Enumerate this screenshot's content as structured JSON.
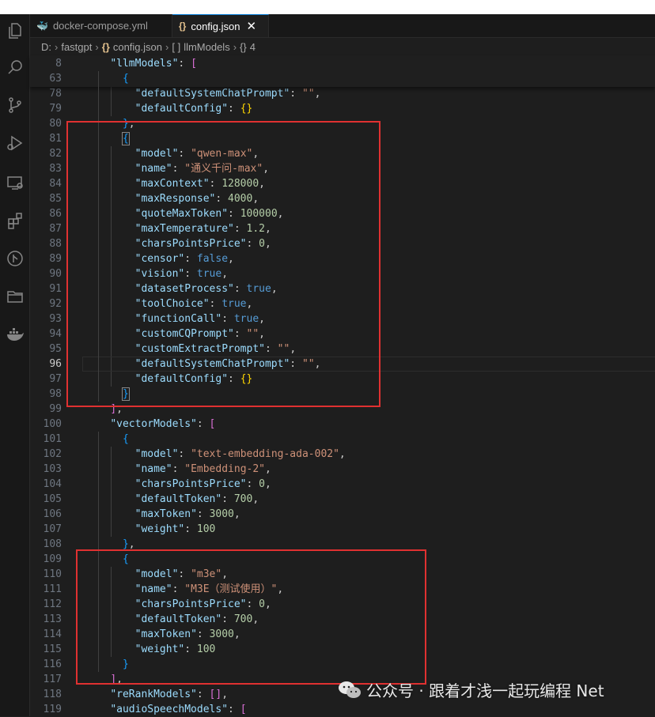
{
  "tabs": [
    {
      "label": "docker-compose.yml",
      "icon": "docker-icon",
      "active": false
    },
    {
      "label": "config.json",
      "icon": "json-braces-icon",
      "active": true,
      "close": "✕"
    }
  ],
  "breadcrumb": {
    "items": [
      "D:",
      "fastgpt",
      "config.json",
      "llmModels",
      "4"
    ],
    "icons": [
      "",
      "",
      "{}",
      "[ ]",
      "{}"
    ]
  },
  "editor": {
    "current_line": "96",
    "lines": [
      {
        "n": "8",
        "t": [
          [
            "p",
            "    "
          ],
          [
            "k",
            "\"llmModels\""
          ],
          [
            "p",
            ": "
          ],
          [
            "br2",
            "["
          ]
        ]
      },
      {
        "n": "63",
        "t": [
          [
            "p",
            "      "
          ],
          [
            "br3",
            "{"
          ]
        ]
      },
      {
        "n": "78",
        "t": [
          [
            "p",
            "        "
          ],
          [
            "k",
            "\"defaultSystemChatPrompt\""
          ],
          [
            "p",
            ": "
          ],
          [
            "s",
            "\"\""
          ],
          [
            "p",
            ","
          ]
        ]
      },
      {
        "n": "79",
        "t": [
          [
            "p",
            "        "
          ],
          [
            "k",
            "\"defaultConfig\""
          ],
          [
            "p",
            ": "
          ],
          [
            "br1",
            "{}"
          ]
        ]
      },
      {
        "n": "80",
        "t": [
          [
            "p",
            "      "
          ],
          [
            "br3",
            "}"
          ],
          [
            "p",
            ","
          ]
        ]
      },
      {
        "n": "81",
        "t": [
          [
            "p",
            "      "
          ],
          [
            "br3",
            "{"
          ]
        ]
      },
      {
        "n": "82",
        "t": [
          [
            "p",
            "        "
          ],
          [
            "k",
            "\"model\""
          ],
          [
            "p",
            ": "
          ],
          [
            "s",
            "\"qwen-max\""
          ],
          [
            "p",
            ","
          ]
        ]
      },
      {
        "n": "83",
        "t": [
          [
            "p",
            "        "
          ],
          [
            "k",
            "\"name\""
          ],
          [
            "p",
            ": "
          ],
          [
            "s",
            "\"通义千问-max\""
          ],
          [
            "p",
            ","
          ]
        ]
      },
      {
        "n": "84",
        "t": [
          [
            "p",
            "        "
          ],
          [
            "k",
            "\"maxContext\""
          ],
          [
            "p",
            ": "
          ],
          [
            "n",
            "128000"
          ],
          [
            "p",
            ","
          ]
        ]
      },
      {
        "n": "85",
        "t": [
          [
            "p",
            "        "
          ],
          [
            "k",
            "\"maxResponse\""
          ],
          [
            "p",
            ": "
          ],
          [
            "n",
            "4000"
          ],
          [
            "p",
            ","
          ]
        ]
      },
      {
        "n": "86",
        "t": [
          [
            "p",
            "        "
          ],
          [
            "k",
            "\"quoteMaxToken\""
          ],
          [
            "p",
            ": "
          ],
          [
            "n",
            "100000"
          ],
          [
            "p",
            ","
          ]
        ]
      },
      {
        "n": "87",
        "t": [
          [
            "p",
            "        "
          ],
          [
            "k",
            "\"maxTemperature\""
          ],
          [
            "p",
            ": "
          ],
          [
            "n",
            "1.2"
          ],
          [
            "p",
            ","
          ]
        ]
      },
      {
        "n": "88",
        "t": [
          [
            "p",
            "        "
          ],
          [
            "k",
            "\"charsPointsPrice\""
          ],
          [
            "p",
            ": "
          ],
          [
            "n",
            "0"
          ],
          [
            "p",
            ","
          ]
        ]
      },
      {
        "n": "89",
        "t": [
          [
            "p",
            "        "
          ],
          [
            "k",
            "\"censor\""
          ],
          [
            "p",
            ": "
          ],
          [
            "b",
            "false"
          ],
          [
            "p",
            ","
          ]
        ]
      },
      {
        "n": "90",
        "t": [
          [
            "p",
            "        "
          ],
          [
            "k",
            "\"vision\""
          ],
          [
            "p",
            ": "
          ],
          [
            "b",
            "true"
          ],
          [
            "p",
            ","
          ]
        ]
      },
      {
        "n": "91",
        "t": [
          [
            "p",
            "        "
          ],
          [
            "k",
            "\"datasetProcess\""
          ],
          [
            "p",
            ": "
          ],
          [
            "b",
            "true"
          ],
          [
            "p",
            ","
          ]
        ]
      },
      {
        "n": "92",
        "t": [
          [
            "p",
            "        "
          ],
          [
            "k",
            "\"toolChoice\""
          ],
          [
            "p",
            ": "
          ],
          [
            "b",
            "true"
          ],
          [
            "p",
            ","
          ]
        ]
      },
      {
        "n": "93",
        "t": [
          [
            "p",
            "        "
          ],
          [
            "k",
            "\"functionCall\""
          ],
          [
            "p",
            ": "
          ],
          [
            "b",
            "true"
          ],
          [
            "p",
            ","
          ]
        ]
      },
      {
        "n": "94",
        "t": [
          [
            "p",
            "        "
          ],
          [
            "k",
            "\"customCQPrompt\""
          ],
          [
            "p",
            ": "
          ],
          [
            "s",
            "\"\""
          ],
          [
            "p",
            ","
          ]
        ]
      },
      {
        "n": "95",
        "t": [
          [
            "p",
            "        "
          ],
          [
            "k",
            "\"customExtractPrompt\""
          ],
          [
            "p",
            ": "
          ],
          [
            "s",
            "\"\""
          ],
          [
            "p",
            ","
          ]
        ]
      },
      {
        "n": "96",
        "t": [
          [
            "p",
            "        "
          ],
          [
            "k",
            "\"defaultSystemChatPrompt\""
          ],
          [
            "p",
            ": "
          ],
          [
            "s",
            "\"\""
          ],
          [
            "p",
            ","
          ]
        ]
      },
      {
        "n": "97",
        "t": [
          [
            "p",
            "        "
          ],
          [
            "k",
            "\"defaultConfig\""
          ],
          [
            "p",
            ": "
          ],
          [
            "br1",
            "{}"
          ]
        ]
      },
      {
        "n": "98",
        "t": [
          [
            "p",
            "      "
          ],
          [
            "br3",
            "}"
          ]
        ]
      },
      {
        "n": "99",
        "t": [
          [
            "p",
            "    "
          ],
          [
            "br2",
            "]"
          ],
          [
            "p",
            ","
          ]
        ]
      },
      {
        "n": "100",
        "t": [
          [
            "p",
            "    "
          ],
          [
            "k",
            "\"vectorModels\""
          ],
          [
            "p",
            ": "
          ],
          [
            "br2",
            "["
          ]
        ]
      },
      {
        "n": "101",
        "t": [
          [
            "p",
            "      "
          ],
          [
            "br3",
            "{"
          ]
        ]
      },
      {
        "n": "102",
        "t": [
          [
            "p",
            "        "
          ],
          [
            "k",
            "\"model\""
          ],
          [
            "p",
            ": "
          ],
          [
            "s",
            "\"text-embedding-ada-002\""
          ],
          [
            "p",
            ","
          ]
        ]
      },
      {
        "n": "103",
        "t": [
          [
            "p",
            "        "
          ],
          [
            "k",
            "\"name\""
          ],
          [
            "p",
            ": "
          ],
          [
            "s",
            "\"Embedding-2\""
          ],
          [
            "p",
            ","
          ]
        ]
      },
      {
        "n": "104",
        "t": [
          [
            "p",
            "        "
          ],
          [
            "k",
            "\"charsPointsPrice\""
          ],
          [
            "p",
            ": "
          ],
          [
            "n",
            "0"
          ],
          [
            "p",
            ","
          ]
        ]
      },
      {
        "n": "105",
        "t": [
          [
            "p",
            "        "
          ],
          [
            "k",
            "\"defaultToken\""
          ],
          [
            "p",
            ": "
          ],
          [
            "n",
            "700"
          ],
          [
            "p",
            ","
          ]
        ]
      },
      {
        "n": "106",
        "t": [
          [
            "p",
            "        "
          ],
          [
            "k",
            "\"maxToken\""
          ],
          [
            "p",
            ": "
          ],
          [
            "n",
            "3000"
          ],
          [
            "p",
            ","
          ]
        ]
      },
      {
        "n": "107",
        "t": [
          [
            "p",
            "        "
          ],
          [
            "k",
            "\"weight\""
          ],
          [
            "p",
            ": "
          ],
          [
            "n",
            "100"
          ]
        ]
      },
      {
        "n": "108",
        "t": [
          [
            "p",
            "      "
          ],
          [
            "br3",
            "}"
          ],
          [
            "p",
            ","
          ]
        ]
      },
      {
        "n": "109",
        "t": [
          [
            "p",
            "      "
          ],
          [
            "br3",
            "{"
          ]
        ]
      },
      {
        "n": "110",
        "t": [
          [
            "p",
            "        "
          ],
          [
            "k",
            "\"model\""
          ],
          [
            "p",
            ": "
          ],
          [
            "s",
            "\"m3e\""
          ],
          [
            "p",
            ","
          ]
        ]
      },
      {
        "n": "111",
        "t": [
          [
            "p",
            "        "
          ],
          [
            "k",
            "\"name\""
          ],
          [
            "p",
            ": "
          ],
          [
            "s",
            "\"M3E（测试使用）\""
          ],
          [
            "p",
            ","
          ]
        ]
      },
      {
        "n": "112",
        "t": [
          [
            "p",
            "        "
          ],
          [
            "k",
            "\"charsPointsPrice\""
          ],
          [
            "p",
            ": "
          ],
          [
            "n",
            "0"
          ],
          [
            "p",
            ","
          ]
        ]
      },
      {
        "n": "113",
        "t": [
          [
            "p",
            "        "
          ],
          [
            "k",
            "\"defaultToken\""
          ],
          [
            "p",
            ": "
          ],
          [
            "n",
            "700"
          ],
          [
            "p",
            ","
          ]
        ]
      },
      {
        "n": "114",
        "t": [
          [
            "p",
            "        "
          ],
          [
            "k",
            "\"maxToken\""
          ],
          [
            "p",
            ": "
          ],
          [
            "n",
            "3000"
          ],
          [
            "p",
            ","
          ]
        ]
      },
      {
        "n": "115",
        "t": [
          [
            "p",
            "        "
          ],
          [
            "k",
            "\"weight\""
          ],
          [
            "p",
            ": "
          ],
          [
            "n",
            "100"
          ]
        ]
      },
      {
        "n": "116",
        "t": [
          [
            "p",
            "      "
          ],
          [
            "br3",
            "}"
          ]
        ]
      },
      {
        "n": "117",
        "t": [
          [
            "p",
            "    "
          ],
          [
            "br2",
            "]"
          ],
          [
            "p",
            ","
          ]
        ]
      },
      {
        "n": "118",
        "t": [
          [
            "p",
            "    "
          ],
          [
            "k",
            "\"reRankModels\""
          ],
          [
            "p",
            ": "
          ],
          [
            "br2",
            "[]"
          ],
          [
            "p",
            ","
          ]
        ]
      },
      {
        "n": "119",
        "t": [
          [
            "p",
            "    "
          ],
          [
            "k",
            "\"audioSpeechModels\""
          ],
          [
            "p",
            ": "
          ],
          [
            "br2",
            "["
          ]
        ]
      }
    ]
  },
  "watermark": {
    "text": "公众号 · 跟着才浅一起玩编程 Net",
    "icon": "wechat-icon"
  },
  "colors": {
    "key": "#9cdcfe",
    "string": "#ce9178",
    "number": "#b5cea8",
    "boolean": "#569cd6",
    "annotation_box": "#e03131"
  }
}
